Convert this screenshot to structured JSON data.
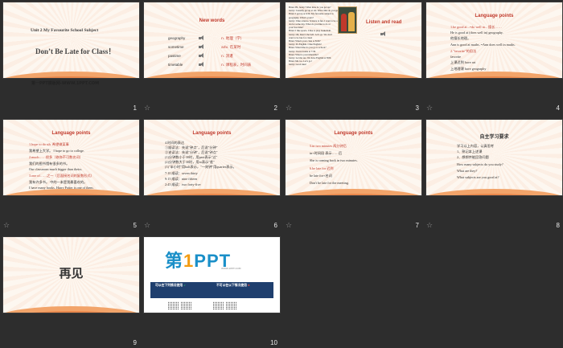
{
  "slides": [
    {
      "number": "1",
      "unit": "Unit 2 My Favourite School Subject",
      "title": "Don’t Be Late for Class！",
      "site": "第一PPT模板网-WWW.1PPT.COM"
    },
    {
      "number": "2",
      "title": "New words",
      "words": [
        {
          "en": "geography",
          "cn": "n. 地理（学）"
        },
        {
          "en": "sometime",
          "cn": "adv. 在某时"
        },
        {
          "en": "pastime",
          "cn": "n. 消遣"
        },
        {
          "en": "timetable",
          "cn": "n. 课程表，时间表"
        }
      ]
    },
    {
      "number": "3",
      "title": "Listen and read",
      "dialog": [
        "Brian: Hi, Jenny! What time do you get up?",
        "Jenny: I usually get up at six. What time do you get up?",
        "Brian: I get up at 6:30. My favourite subject is",
        "geography. What's yours?",
        "Jenny: I like science. Science is fun. I want to be a",
        "doctor some day. What do you like to do at",
        "your free time?",
        "Brian: I like sports. I like to play basketball.",
        "Jenny: Oh, there's the bell. Let's go. We don't",
        "want to be late for class!",
        "Brian: What's your class at 8:00?",
        "Jenny: It's English. I like English!",
        "Brian: What time do you go to school?",
        "Jenny: I leave home at 7:30.",
        "Brian: What is your timetable?",
        "Jenny: Let me see. We have English at 8:00.",
        "Brian: Me too. Let's go!",
        "Jenny: Good idea!"
      ]
    },
    {
      "number": "4",
      "title": "Language points",
      "lines": [
        "1.be good at...=do well in... 擅长……",
        "He is good at (does well in) geography.",
        "他擅长地理。",
        "Ann is good at maths. =Ann does well in maths.",
        "2.\"favorite\"的用法",
        "         favorite",
        "上课迟到          have art",
        "上地理课          have geography"
      ]
    },
    {
      "number": "5",
      "title": "Language points",
      "lines": [
        "1.hope to do sth. 希望做某事",
        "我希望上大学。 I hope to go to college.",
        "2.much……很多（修饰不可数名词）",
        "我们的图书馆有很多的书。",
        "Our classroom much bigger than theirs.",
        "3.one of……之一（后面接名词的复数形式）",
        "我有许多书。 中的一本是我最喜欢的。",
        "I have many books. Harry Potter is one of them."
      ]
    },
    {
      "number": "6",
      "title": "Language points",
      "lines": [
        "4.时间的表达",
        "①顺读法：先说\"钟点\"，后说\"分钟\"",
        "②逆读法：先说\"分钟\"，后说\"钟点\"",
        "(1)分钟数小于30时，用past表示\"过\"",
        "(2)分钟数大于30时，用to表示\"差\"",
        "(3)\"半小时\"用half表示，\"一刻钟\"用quarter表示。",
        "7:10 顺读：seven thirty",
        "9:15 顺读：nine fifteen",
        "2:45 顺读：two forty-five"
      ]
    },
    {
      "number": "7",
      "title": "Language points",
      "lines": [
        "5.in two minutes 两分钟后",
        "in+时间段 表示……后",
        "She is coming back in two minutes.",
        "6.be late for 迟到",
        "be late for+名词",
        "Don't be late for the meeting."
      ]
    },
    {
      "number": "8",
      "title": "自主学习要求",
      "lines": [
        "学习以上内容，认真思考",
        "1、熟记本上述课",
        "2、想想并能回答问题",
        "How many subjects do you study?",
        "What are they?",
        "What subjects are you good at?"
      ]
    },
    {
      "number": "9",
      "text": "再见"
    },
    {
      "number": "10",
      "logo_main": "第",
      "logo_one": "1",
      "logo_rest": "PPT",
      "logo_sub": "WWW.1PPT.COM",
      "left_head": "可以在下列情况使用",
      "right_head": "不可以在以下情况使用"
    }
  ]
}
